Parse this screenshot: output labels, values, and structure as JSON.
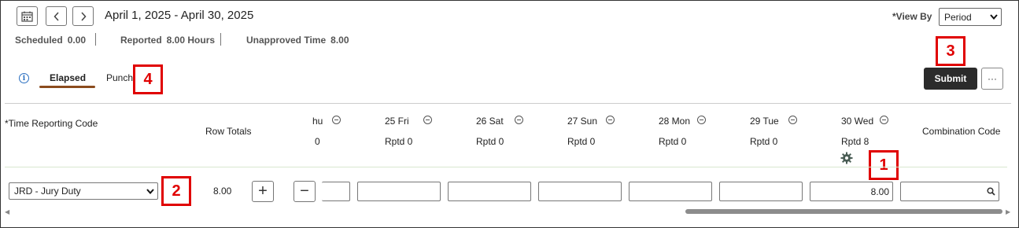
{
  "header": {
    "date_range": "April 1, 2025 - April 30, 2025",
    "view_by_label": "*View By",
    "view_by_value": "Period"
  },
  "summary": {
    "scheduled_label": "Scheduled",
    "scheduled_value": "0.00",
    "reported_label": "Reported",
    "reported_value": "8.00 Hours",
    "unapproved_label": "Unapproved Time",
    "unapproved_value": "8.00"
  },
  "tabs": [
    {
      "label": "Elapsed"
    },
    {
      "label": "Punch"
    }
  ],
  "actions": {
    "submit_label": "Submit",
    "more_label": "···"
  },
  "markers": [
    "1",
    "2",
    "3",
    "4"
  ],
  "grid": {
    "trc_header": "*Time Reporting Code",
    "row_totals_header": "Row Totals",
    "combination_header": "Combination Code",
    "partial_day": {
      "label": "hu",
      "rptd": "0"
    },
    "days": [
      {
        "label": "25 Fri",
        "rptd": "Rptd 0",
        "value": ""
      },
      {
        "label": "26 Sat",
        "rptd": "Rptd 0",
        "value": ""
      },
      {
        "label": "27 Sun",
        "rptd": "Rptd 0",
        "value": ""
      },
      {
        "label": "28 Mon",
        "rptd": "Rptd 0",
        "value": ""
      },
      {
        "label": "29 Tue",
        "rptd": "Rptd 0",
        "value": ""
      },
      {
        "label": "30 Wed",
        "rptd": "Rptd 8",
        "value": "8.00"
      }
    ],
    "row": {
      "trc_value": "JRD - Jury Duty",
      "row_total": "8.00"
    }
  },
  "icons": [
    "calendar-icon",
    "chevron-left-icon",
    "chevron-right-icon",
    "info-icon",
    "collapse-circle-icon",
    "gear-icon",
    "search-icon",
    "plus-icon",
    "minus-icon"
  ]
}
